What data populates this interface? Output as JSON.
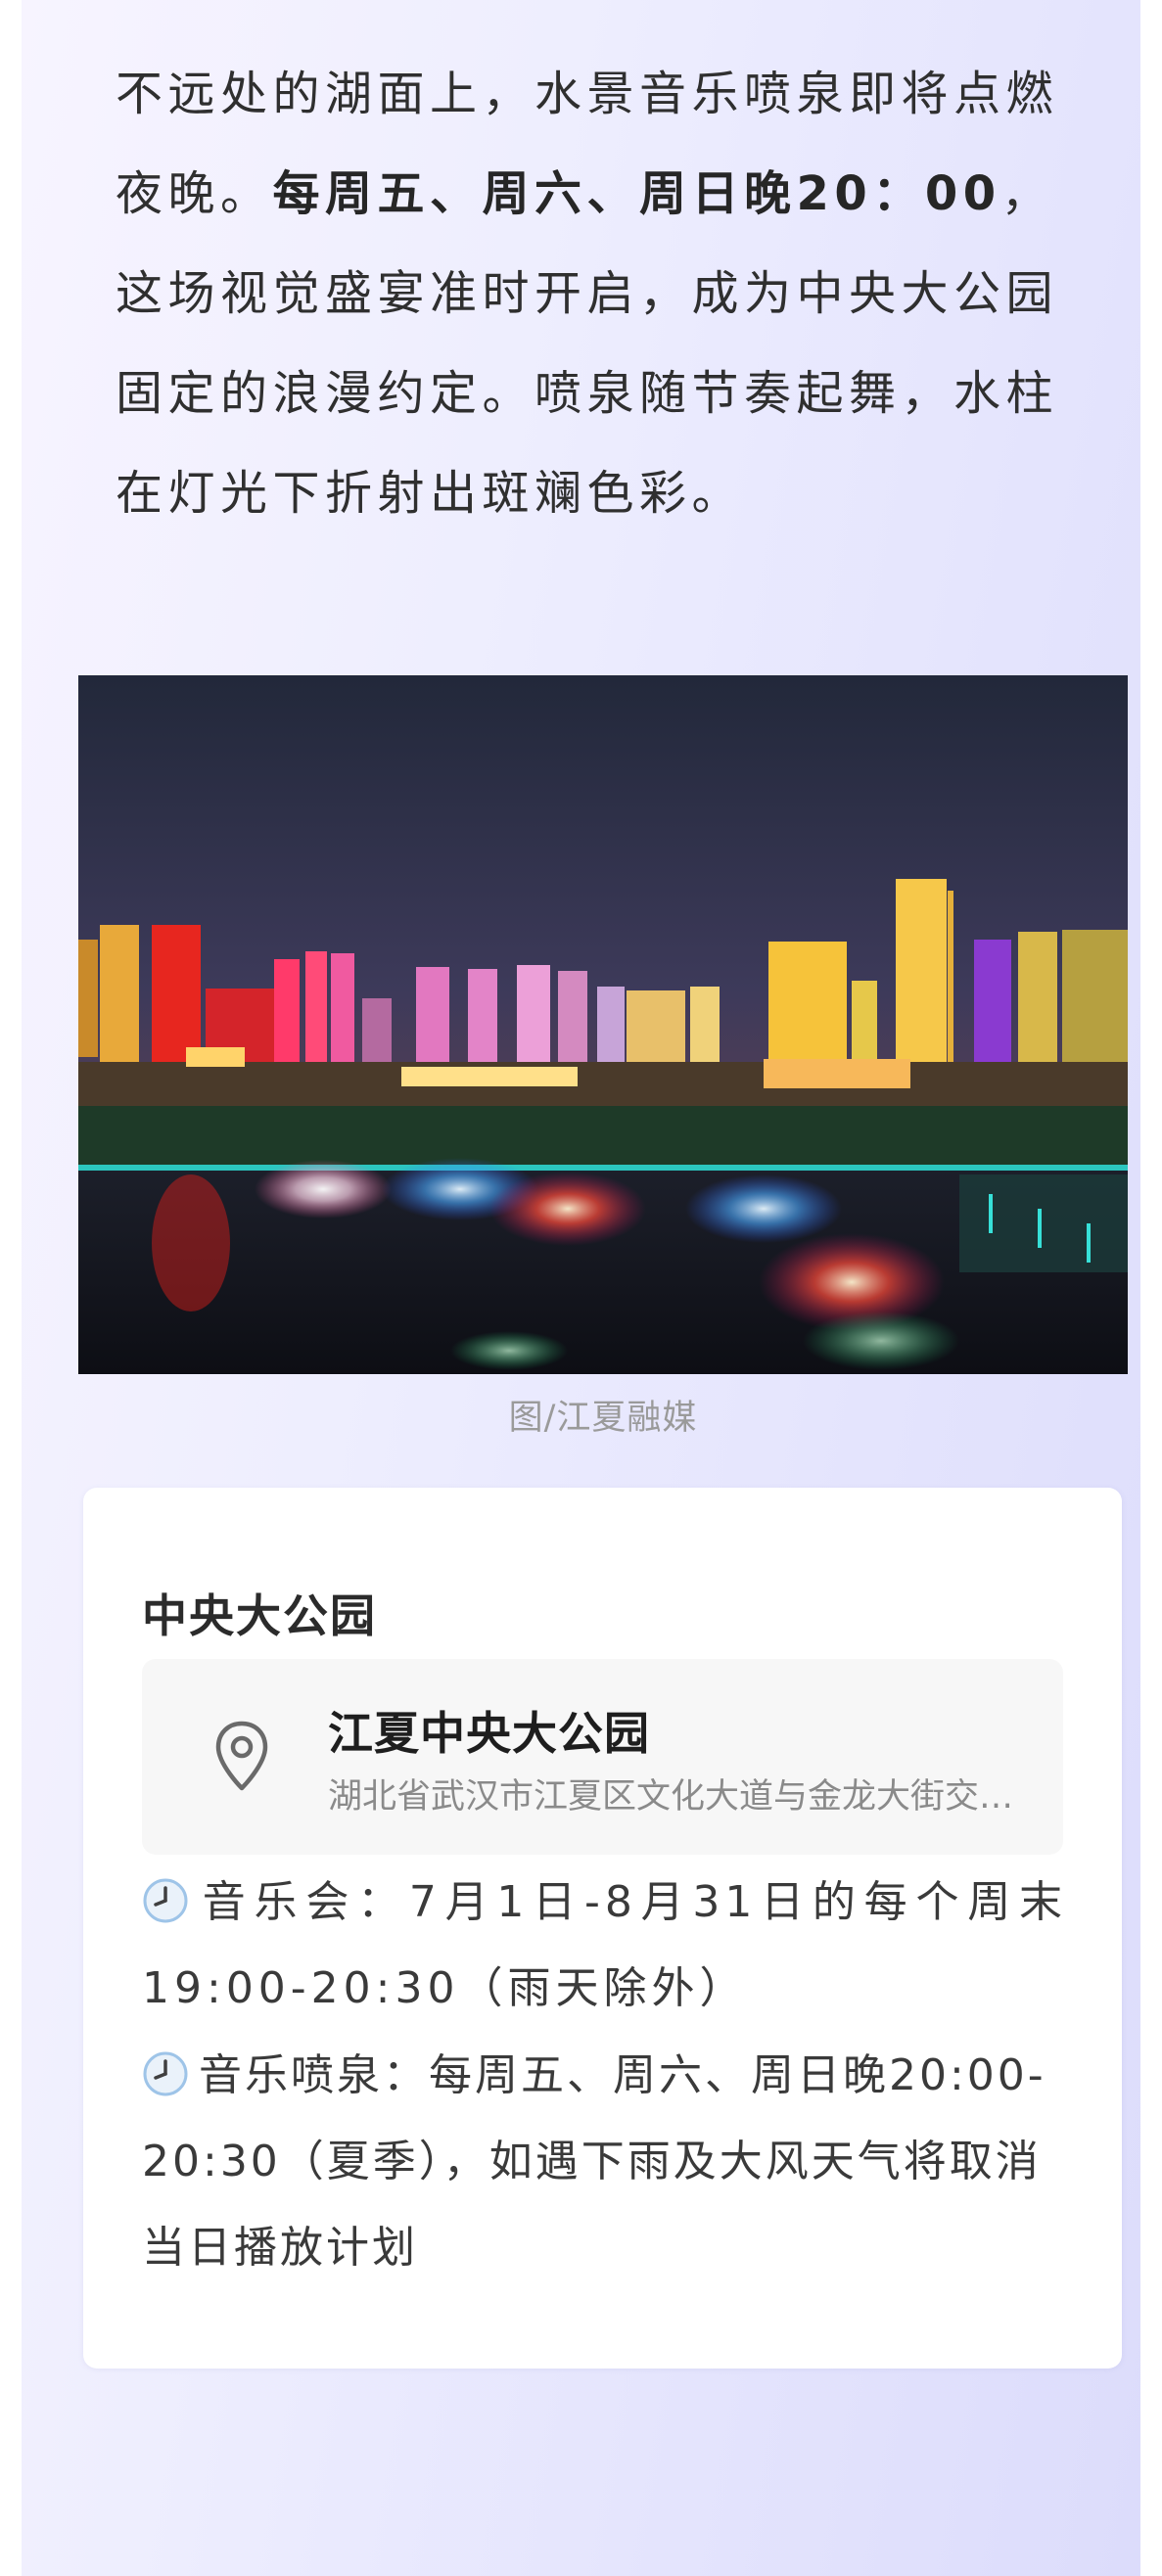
{
  "article": {
    "intro_before": "不远处的湖面上，水景音乐喷泉即将点燃夜晚。",
    "intro_bold": "每周五、周六、周日晚20：00",
    "intro_after": "，这场视觉盛宴准时开启，成为中央大公园固定的浪漫约定。喷泉随节奏起舞，水柱在灯光下折射出斑斓色彩。"
  },
  "photo": {
    "caption": "图/江夏融媒"
  },
  "location_card": {
    "title": "中央大公园",
    "place_name": "江夏中央大公园",
    "address": "湖北省武汉市江夏区文化大道与金龙大街交汇处",
    "icon": "location-pin-icon",
    "schedule": [
      {
        "icon": "clock-icon",
        "text": "音乐会：7月1日-8月31日的每个周末19:00-20:30（雨天除外）"
      },
      {
        "icon": "clock-icon",
        "text": "音乐喷泉：每周五、周六、周日晚20:00-20:30（夏季），如遇下雨及大风天气将取消当日播放计划"
      }
    ]
  }
}
